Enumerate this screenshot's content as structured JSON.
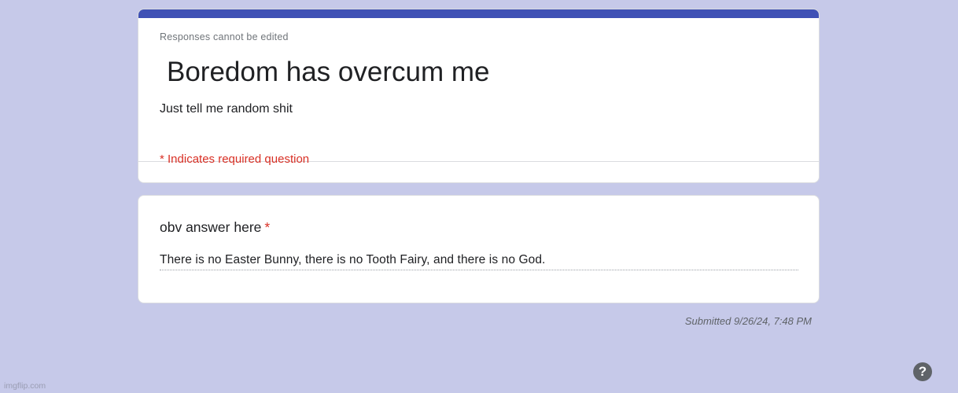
{
  "form": {
    "notice": "Responses cannot be edited",
    "title": "Boredom has overcum me",
    "description": "Just tell me random shit",
    "required_note": "* Indicates required question",
    "accent_color": "#3f51b5"
  },
  "question": {
    "title": "obv answer here",
    "required_marker": "*",
    "answer": "There is no Easter Bunny, there is no Tooth Fairy, and there is no God."
  },
  "footer": {
    "submitted": "Submitted 9/26/24, 7:48 PM",
    "help_icon": "help-icon",
    "help_glyph": "?",
    "watermark": "imgflip.com"
  }
}
